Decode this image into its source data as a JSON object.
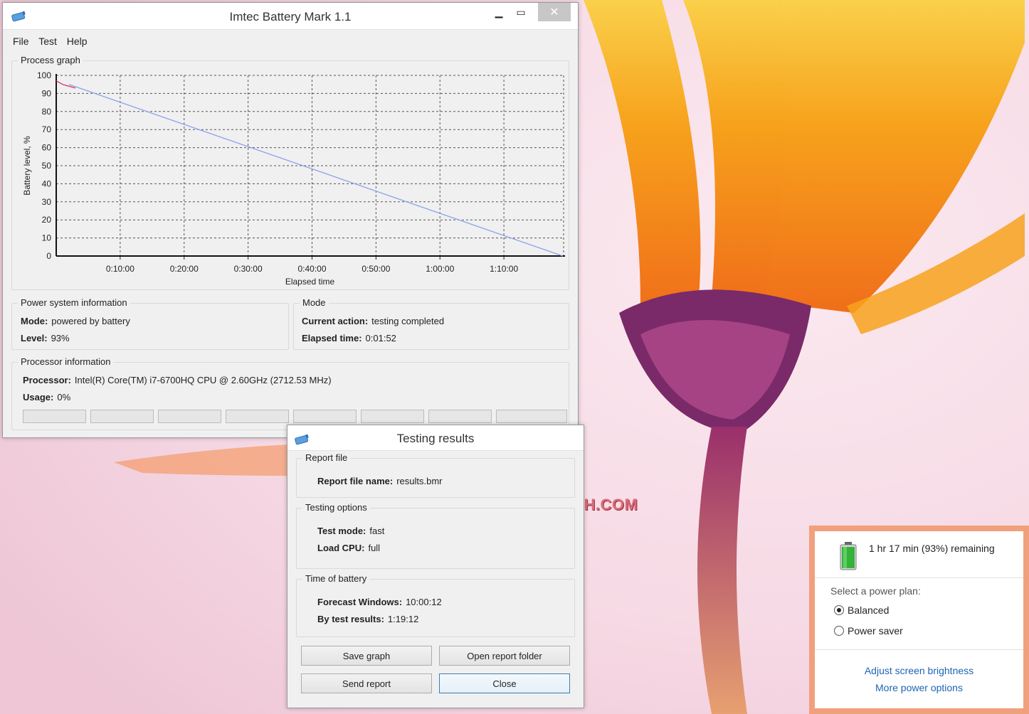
{
  "main_window": {
    "title": "Imtec Battery Mark 1.1",
    "menu": [
      "File",
      "Test",
      "Help"
    ],
    "process_graph": {
      "label": "Process graph",
      "chart_data": {
        "type": "line",
        "xlabel": "Elapsed time",
        "ylabel": "Battery level, %",
        "ylim": [
          0,
          100
        ],
        "x_ticks": [
          "0:10:00",
          "0:20:00",
          "0:30:00",
          "0:40:00",
          "0:50:00",
          "1:00:00",
          "1:10:00"
        ],
        "y_ticks": [
          0,
          10,
          20,
          30,
          40,
          50,
          60,
          70,
          80,
          90,
          100
        ],
        "xlim_seconds": [
          0,
          4760
        ],
        "grid": true,
        "series": [
          {
            "color": "#e0305a",
            "points": [
              [
                0,
                97
              ],
              [
                30,
                96
              ],
              [
                60,
                95
              ],
              [
                90,
                94.5
              ],
              [
                120,
                94
              ],
              [
                150,
                93.5
              ],
              [
                180,
                93
              ]
            ]
          },
          {
            "color": "#8aa2ec",
            "points": [
              [
                120,
                95
              ],
              [
                4752,
                0
              ]
            ]
          }
        ]
      }
    },
    "power_info": {
      "label": "Power system information",
      "mode_label": "Mode:",
      "mode_value": "powered by battery",
      "level_label": "Level:",
      "level_value": "93%"
    },
    "mode": {
      "label": "Mode",
      "action_label": "Current action:",
      "action_value": "testing completed",
      "elapsed_label": "Elapsed time:",
      "elapsed_value": "0:01:52"
    },
    "processor": {
      "label": "Processor information",
      "processor_label": "Processor:",
      "processor_value": "Intel(R) Core(TM) i7-6700HQ CPU @ 2.60GHz  (2712.53 MHz)",
      "usage_label": "Usage:",
      "usage_value": "0%"
    }
  },
  "results_window": {
    "title": "Testing results",
    "report_file": {
      "label": "Report file",
      "name_label": "Report file name:",
      "name_value": "results.bmr"
    },
    "testing_options": {
      "label": "Testing options",
      "mode_label": "Test mode:",
      "mode_value": "fast",
      "cpu_label": "Load CPU:",
      "cpu_value": "full"
    },
    "time_of_battery": {
      "label": "Time of battery",
      "forecast_label": "Forecast Windows:",
      "forecast_value": "10:00:12",
      "test_label": "By test results:",
      "test_value": "1:19:12"
    },
    "buttons": {
      "save_graph": "Save graph",
      "open_folder": "Open report folder",
      "send_report": "Send report",
      "close": "Close"
    }
  },
  "battery_flyout": {
    "status": "1 hr 17 min (93%) remaining",
    "plan_label": "Select a power plan:",
    "plans": [
      {
        "label": "Balanced",
        "selected": true
      },
      {
        "label": "Power saver",
        "selected": false
      }
    ],
    "link_brightness": "Adjust screen brightness",
    "link_more": "More power options",
    "accent": "#f0a07c"
  },
  "watermark": {
    "text": "VMODTECH.COM"
  }
}
